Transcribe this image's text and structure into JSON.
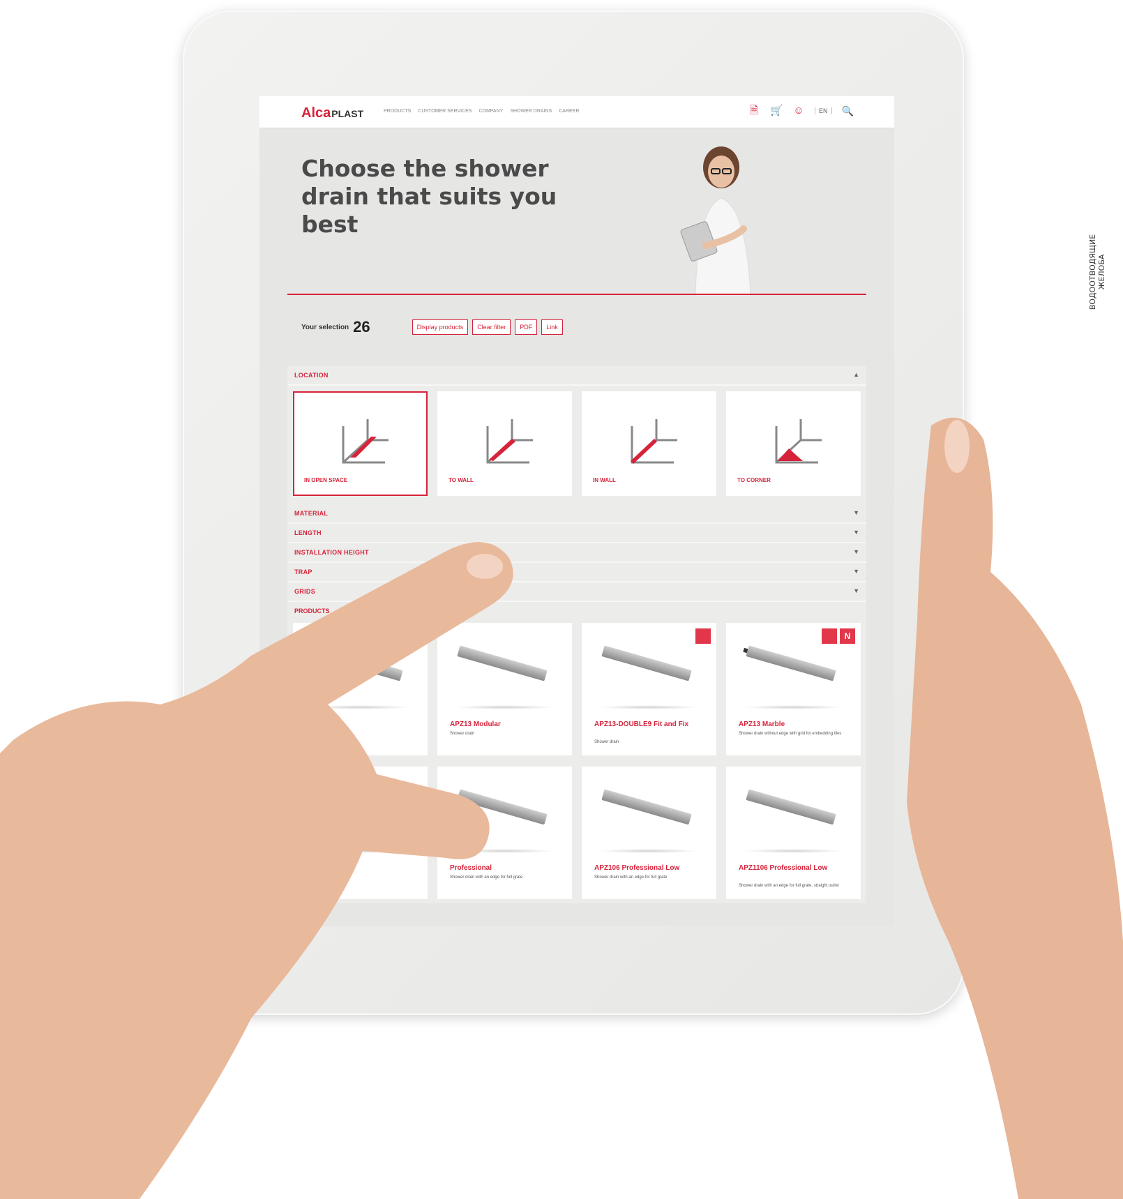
{
  "side_caption": "ВОДООТВОДЯЩИЕ ЖЕЛОБА",
  "header": {
    "logo_alca": "Alca",
    "logo_plast": "PLAST",
    "nav": [
      "PRODUCTS",
      "CUSTOMER SERVICES",
      "COMPANY",
      "SHOWER DRAINS",
      "CAREER"
    ],
    "lang": "EN"
  },
  "hero": {
    "title": "Choose the shower drain that suits you best"
  },
  "selection": {
    "label": "Your selection",
    "count": "26",
    "buttons": [
      "Display products",
      "Clear filter",
      "PDF",
      "Link"
    ]
  },
  "filters": {
    "location": "LOCATION",
    "locations": [
      "IN OPEN SPACE",
      "TO WALL",
      "IN WALL",
      "TO CORNER"
    ],
    "rows": [
      "MATERIAL",
      "LENGTH",
      "INSTALLATION HEIGHT",
      "TRAP",
      "GRIDS"
    ]
  },
  "products": {
    "title": "PRODUCTS",
    "items": [
      {
        "name": "",
        "desc": ""
      },
      {
        "name": "APZ13 Modular",
        "desc": "Shower drain"
      },
      {
        "name": "APZ13-DOUBLE9 Fit and Fix",
        "desc": "Shower drain"
      },
      {
        "name": "APZ13 Marble",
        "desc": "Shower drain without edge with grid for embedding tiles"
      },
      {
        "name": "",
        "desc": ""
      },
      {
        "name": "Professional",
        "desc": "Shower drain with an edge for full grate"
      },
      {
        "name": "APZ106 Professional Low",
        "desc": "Shower drain with an edge for full grate"
      },
      {
        "name": "APZ1106 Professional Low",
        "desc": "Shower drain with an edge for full grate, straight outlet"
      }
    ],
    "badge_new": "N"
  },
  "colors": {
    "accent": "#d6233a"
  }
}
